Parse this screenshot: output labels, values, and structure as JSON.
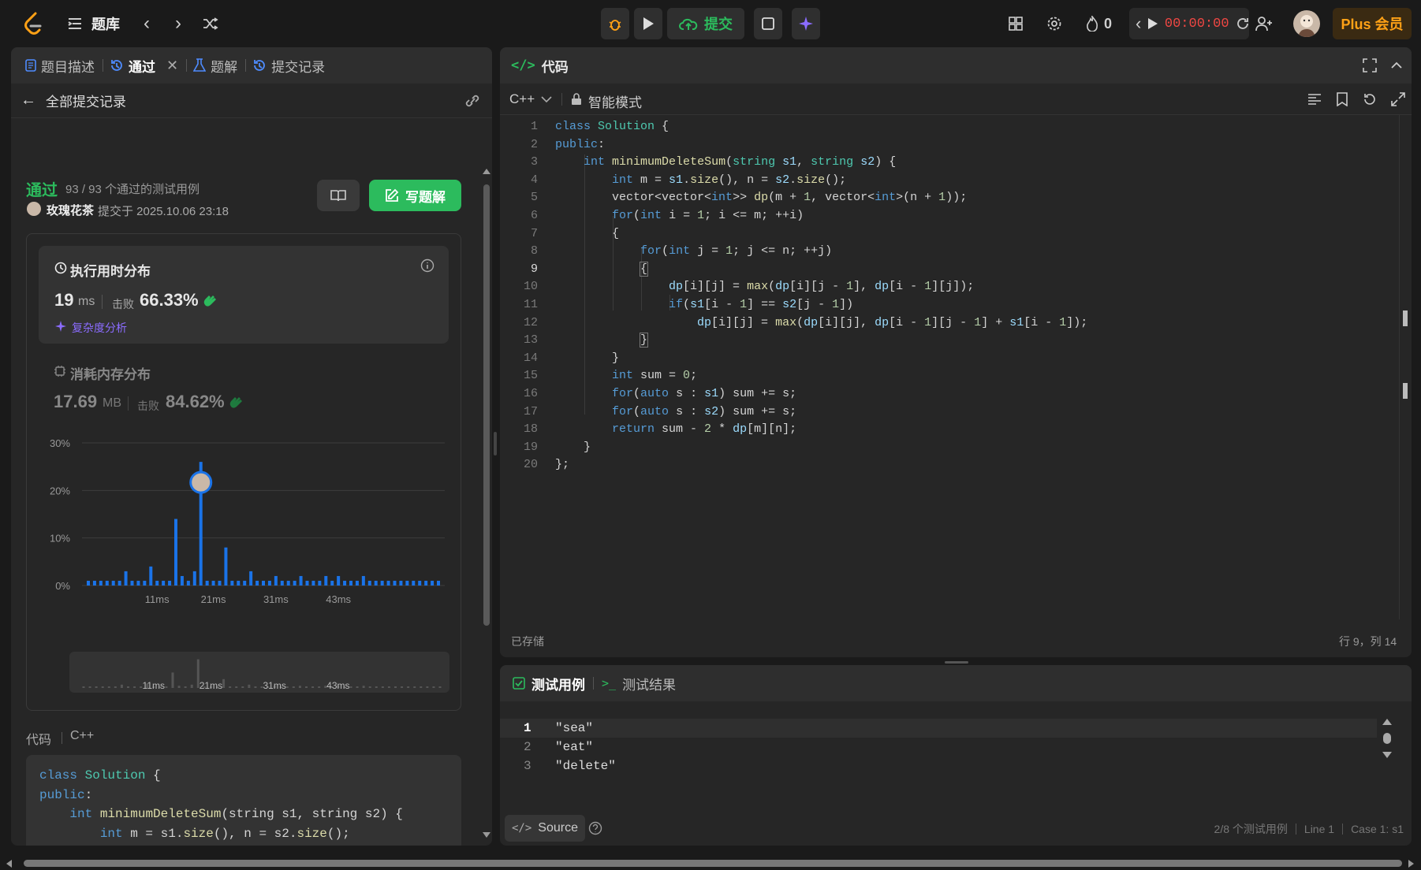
{
  "topbar": {
    "problem_bank": "题库",
    "submit": "提交",
    "streak": "0",
    "timer": "00:00:00",
    "plus": "Plus 会员"
  },
  "left": {
    "tabs": [
      {
        "label": "题目描述"
      },
      {
        "label": "通过"
      },
      {
        "label": "题解"
      },
      {
        "label": "提交记录"
      }
    ],
    "back_label": "全部提交记录",
    "status": "通过",
    "passed_cases": "93 / 93 个通过的测试用例",
    "user": "玫瑰花茶",
    "submitted_at": "提交于 2025.10.06 23:18",
    "write_solution": "写题解",
    "runtime_title": "执行用时分布",
    "runtime_value": "19",
    "runtime_unit": "ms",
    "beats_label": "击败",
    "runtime_beats": "66.33%",
    "complexity": "复杂度分析",
    "memory_title": "消耗内存分布",
    "memory_value": "17.69",
    "memory_unit": "MB",
    "memory_beats": "84.62%",
    "code_label": "代码",
    "code_lang": "C++"
  },
  "chart_data": {
    "type": "bar",
    "title": "",
    "xlabel": "",
    "ylabel": "",
    "ylim": [
      0,
      30
    ],
    "y_ticks": [
      "0%",
      "10%",
      "20%",
      "30%"
    ],
    "x_ticks": [
      "11ms",
      "21ms",
      "31ms",
      "43ms"
    ],
    "series": [
      {
        "values": [
          1,
          1,
          1,
          1,
          1,
          1,
          3,
          1,
          1,
          1,
          4,
          1,
          1,
          1,
          14,
          2,
          1,
          3,
          26,
          1,
          1,
          1,
          8,
          1,
          1,
          1,
          3,
          1,
          1,
          1,
          2,
          1,
          1,
          1,
          2,
          1,
          1,
          1,
          2,
          1,
          2,
          1,
          1,
          1,
          2,
          1,
          1,
          1,
          1,
          1,
          1,
          1,
          1,
          1,
          1,
          1,
          1
        ]
      }
    ],
    "highlight_value": "19ms",
    "grid": true
  },
  "right": {
    "title": "代码",
    "lang": "C++",
    "mode": "智能模式",
    "saved": "已存储",
    "cursor": "行 9，列 14"
  },
  "bottom": {
    "tab_cases": "测试用例",
    "tab_result": "测试结果",
    "source": "Source",
    "status": "2/8 个测试用例",
    "line": "Line 1",
    "case": "Case 1: s1",
    "inputs": [
      "\"sea\"",
      "\"eat\"",
      "\"delete\""
    ]
  }
}
